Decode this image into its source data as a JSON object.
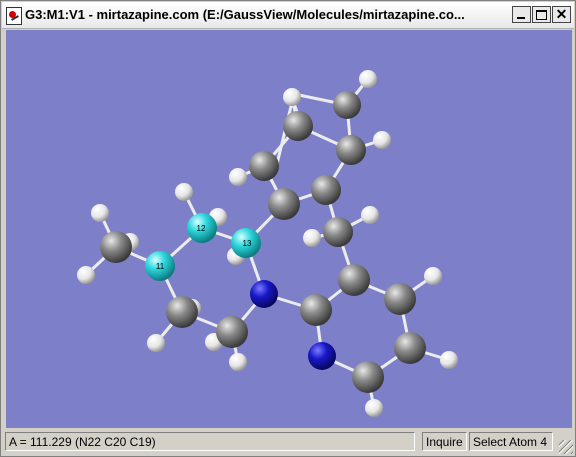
{
  "window": {
    "title": "G3:M1:V1 - mirtazapine.com (E:/GaussView/Molecules/mirtazapine.co...",
    "controls": [
      "minimize",
      "maximize",
      "close"
    ]
  },
  "viewer": {
    "background": "#7d80c8",
    "atom_colors": {
      "carbon": "#7f7f7f",
      "hydrogen": "#f0f0f0",
      "nitrogen": "#1414c8",
      "selected": "#2ad6dc"
    },
    "atom_labels": [
      "12",
      "13",
      "11"
    ]
  },
  "status": {
    "measurement": "A = 111.229 (N22 C20 C19)",
    "mode": "Inquire",
    "action": "Select Atom 4"
  }
}
